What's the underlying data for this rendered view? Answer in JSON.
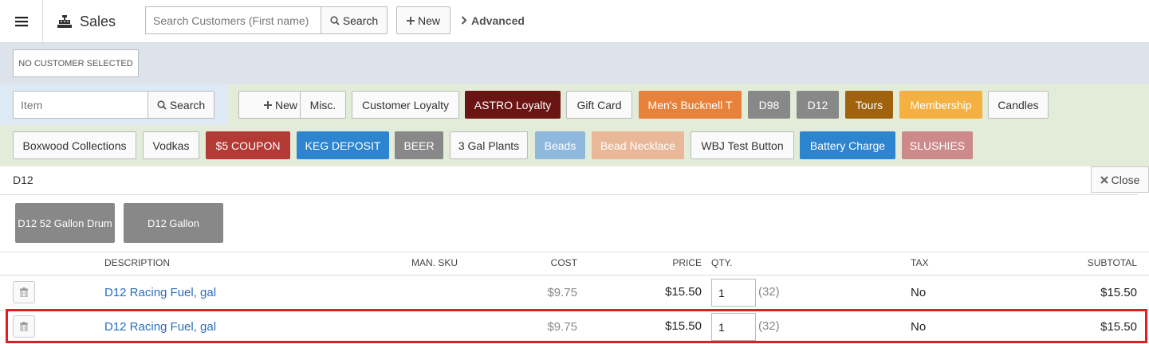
{
  "app": {
    "title": "Sales"
  },
  "customer": {
    "status": "NO CUSTOMER SELECTED",
    "search_placeholder": "Search Customers (First name)",
    "search_label": "Search",
    "new_label": "New",
    "advanced_label": "Advanced"
  },
  "item": {
    "placeholder": "Item",
    "search_label": "Search"
  },
  "quick_buttons": [
    {
      "label": "New",
      "icon": "plus-icon",
      "bg": "#fafafa",
      "fg": "#333333"
    },
    {
      "label": "Misc.",
      "bg": "#fafafa",
      "fg": "#333333"
    },
    {
      "label": "Customer Loyalty",
      "bg": "#fafafa",
      "fg": "#333333"
    },
    {
      "label": "ASTRO Loyalty",
      "bg": "#6b1414",
      "fg": "#ffffff"
    },
    {
      "label": "Gift Card",
      "bg": "#fafafa",
      "fg": "#333333"
    },
    {
      "label": "Men's Bucknell T",
      "bg": "#e8813a",
      "fg": "#ffffff"
    },
    {
      "label": "D98",
      "bg": "#888888",
      "fg": "#ffffff"
    },
    {
      "label": "D12",
      "bg": "#888888",
      "fg": "#ffffff"
    },
    {
      "label": "Tours",
      "bg": "#a0620c",
      "fg": "#ffffff"
    },
    {
      "label": "Membership",
      "bg": "#f5b042",
      "fg": "#ffffff"
    },
    {
      "label": "Candles",
      "bg": "#fafafa",
      "fg": "#333333"
    },
    {
      "label": "Boxwood Collections",
      "bg": "#fafafa",
      "fg": "#333333"
    },
    {
      "label": "Vodkas",
      "bg": "#fafafa",
      "fg": "#333333"
    },
    {
      "label": "$5 COUPON",
      "bg": "#b33a35",
      "fg": "#ffffff"
    },
    {
      "label": "KEG DEPOSIT",
      "bg": "#2d84cf",
      "fg": "#ffffff"
    },
    {
      "label": "BEER",
      "bg": "#888888",
      "fg": "#ffffff"
    },
    {
      "label": "3 Gal Plants",
      "bg": "#fafafa",
      "fg": "#333333"
    },
    {
      "label": "Beads",
      "bg": "#8fb8dd",
      "fg": "#ffffff"
    },
    {
      "label": "Bead Necklace",
      "bg": "#e8b898",
      "fg": "#ffffff"
    },
    {
      "label": "WBJ Test Button",
      "bg": "#fafafa",
      "fg": "#333333"
    },
    {
      "label": "Battery Charge",
      "bg": "#2d84cf",
      "fg": "#ffffff"
    },
    {
      "label": "SLUSHIES",
      "bg": "#cc8a8a",
      "fg": "#ffffff"
    }
  ],
  "category": {
    "title": "D12",
    "close_label": "Close",
    "products": [
      "D12 52 Gallon Drum",
      "D12 Gallon"
    ]
  },
  "table": {
    "headers": {
      "description": "DESCRIPTION",
      "man_sku": "MAN. SKU",
      "cost": "COST",
      "price": "PRICE",
      "qty": "QTY.",
      "tax": "TAX",
      "subtotal": "SUBTOTAL"
    },
    "rows": [
      {
        "description": "D12 Racing Fuel, gal",
        "cost": "$9.75",
        "price": "$15.50",
        "qty": "1",
        "stock": "(32)",
        "tax": "No",
        "subtotal": "$15.50"
      },
      {
        "description": "D12 Racing Fuel, gal",
        "cost": "$9.75",
        "price": "$15.50",
        "qty": "1",
        "stock": "(32)",
        "tax": "No",
        "subtotal": "$15.50"
      }
    ]
  }
}
